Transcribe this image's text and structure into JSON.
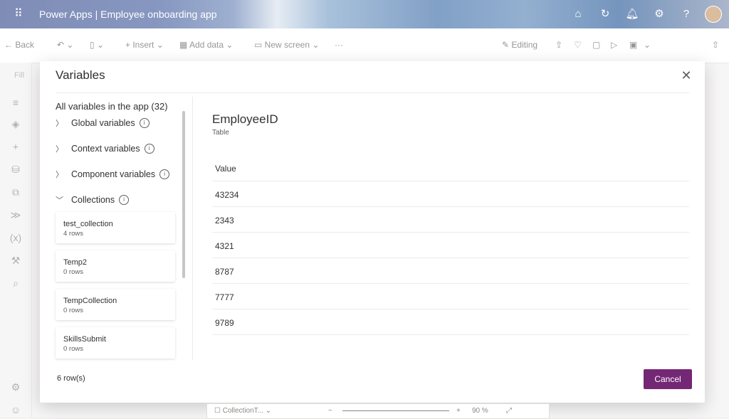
{
  "app": {
    "product": "Power Apps",
    "separator": "|",
    "app_name": "Employee onboarding app"
  },
  "commandbar": {
    "back": "Back",
    "insert": "Insert",
    "add_data": "Add data",
    "new_screen": "New screen",
    "more": "···",
    "editing": "Editing"
  },
  "rail": {
    "fill_label": "Fill"
  },
  "dialog": {
    "title": "Variables",
    "all_vars_label": "All variables in the app (32)",
    "tree": [
      {
        "label": "Global variables"
      },
      {
        "label": "Context variables"
      },
      {
        "label": "Component variables"
      },
      {
        "label": "Collections"
      }
    ],
    "collections": [
      {
        "name": "test_collection",
        "rows": "4 rows"
      },
      {
        "name": "Temp2",
        "rows": "0 rows"
      },
      {
        "name": "TempCollection",
        "rows": "0 rows"
      },
      {
        "name": "SkillsSubmit",
        "rows": "0 rows"
      }
    ],
    "selected": {
      "name": "EmployeeID",
      "type": "Table",
      "column": "Value",
      "values": [
        "43234",
        "2343",
        "4321",
        "8787",
        "7777",
        "9789"
      ]
    },
    "row_count": "6 row(s)",
    "cancel": "Cancel"
  },
  "statusbar": {
    "screen": "CollectionT...",
    "zoom": "90 %"
  }
}
